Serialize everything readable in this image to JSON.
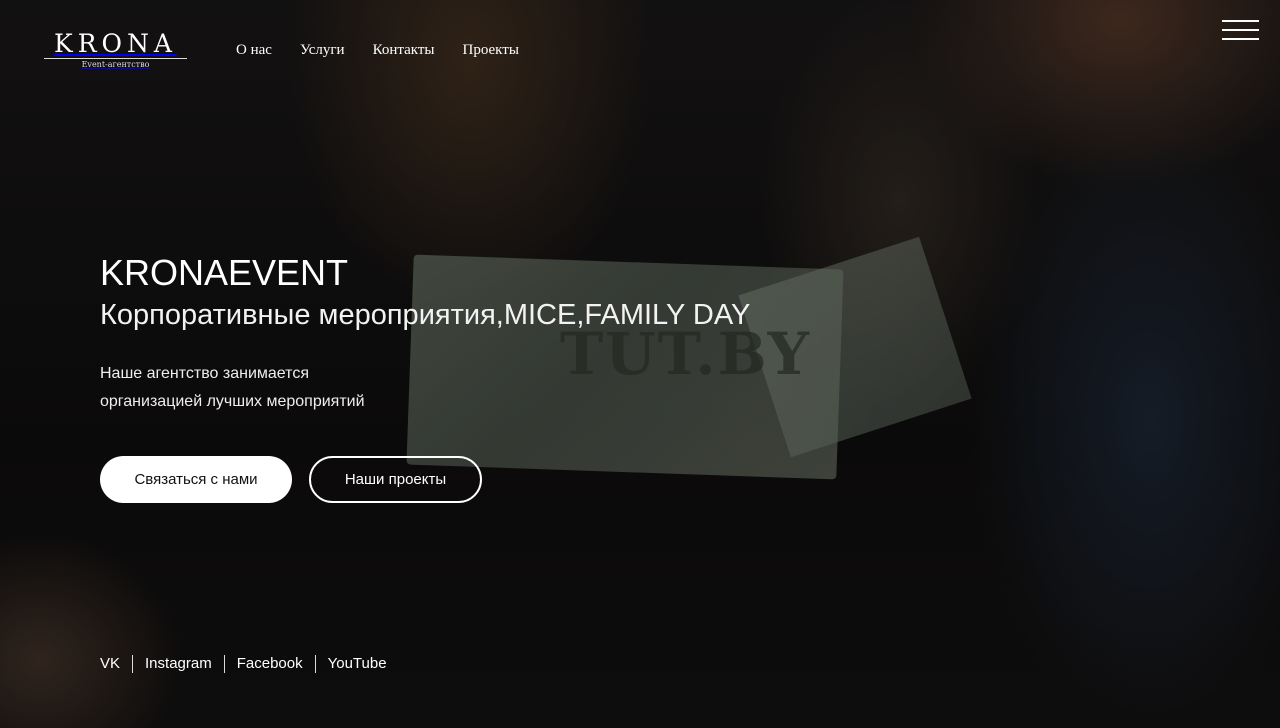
{
  "logo": {
    "name": "KRONA",
    "tagline": "Event-агентство"
  },
  "nav": {
    "items": [
      "О нас",
      "Услуги",
      "Контакты",
      "Проекты"
    ]
  },
  "hero": {
    "title": "KRONAEVENT",
    "subtitle": "Корпоративные мероприятия,MICE,FAMILY DAY",
    "description_line1": "Наше агентство занимается",
    "description_line2": "организацией лучших мероприятий",
    "contact_button": "Связаться с нами",
    "projects_button": "Наши проекты"
  },
  "background": {
    "banknote_text": "TUT.BY"
  },
  "social": {
    "links": [
      "VK",
      "Instagram",
      "Facebook",
      "YouTube"
    ]
  },
  "colors": {
    "button_bg": "#ffffff",
    "button_text": "#111111",
    "text": "#ffffff"
  },
  "icons": {
    "menu": "hamburger-menu-icon"
  }
}
